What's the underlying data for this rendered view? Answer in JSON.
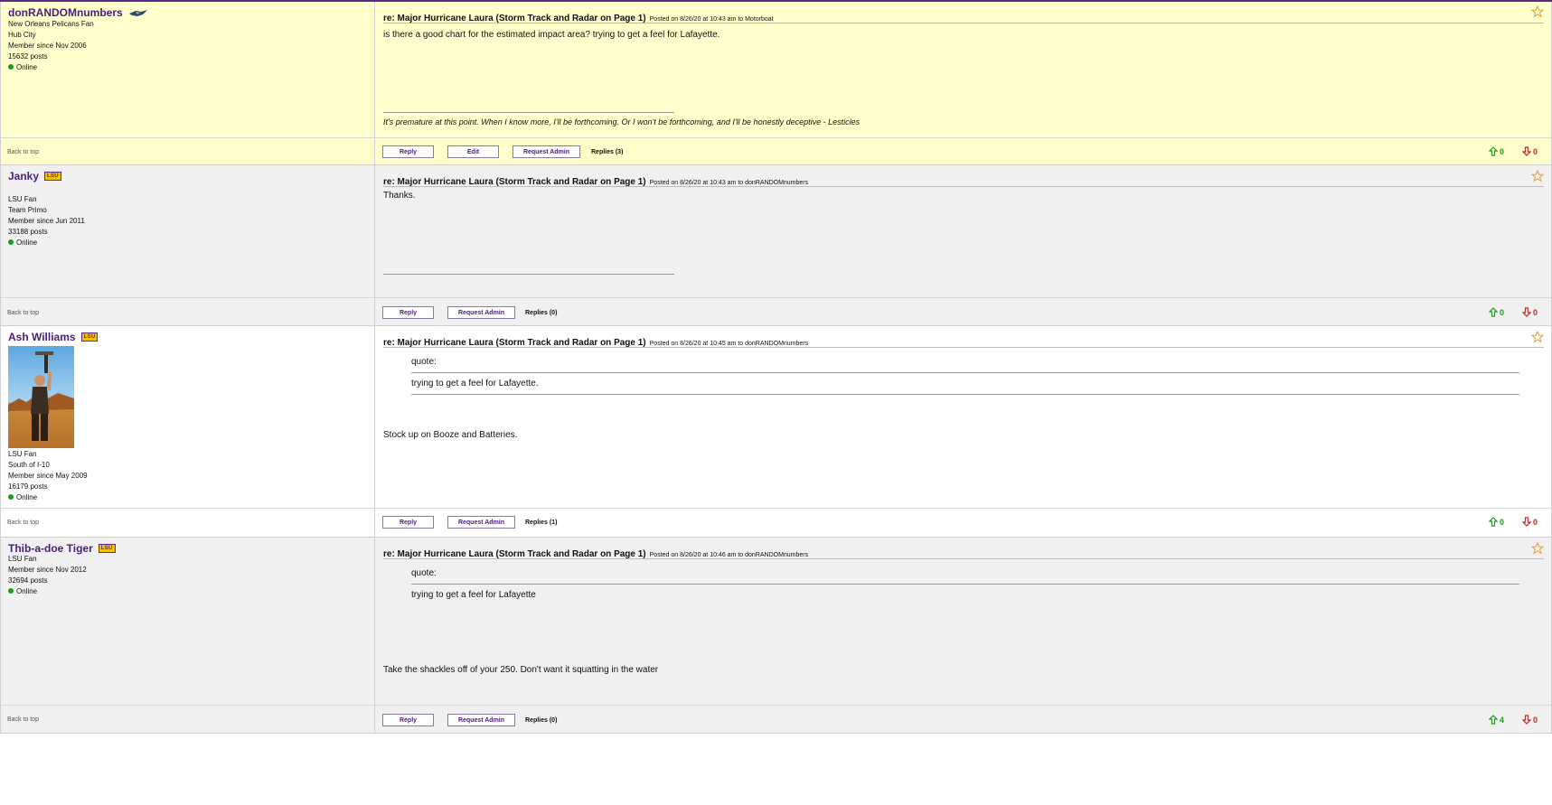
{
  "common": {
    "back_to_top": "Back to top",
    "reply_label": "Reply",
    "edit_label": "Edit",
    "request_admin_label": "Request Admin",
    "quote_label": "quote:",
    "subject_title": "re: Major Hurricane Laura (Storm Track and Radar on Page 1)"
  },
  "colors": {
    "own_post_bg": "#ffffcc",
    "alt_post_bg": "#f0f0f0",
    "white_post_bg": "#ffffff",
    "username": "#4b1c7a",
    "vote_up": "#1e9c1e",
    "vote_down": "#cc2222"
  },
  "posts": [
    {
      "username": "donRANDOMnumbers",
      "badge": "pelican-icon",
      "info": [
        "New Orleans Pelicans Fan",
        "Hub City",
        "Member since Nov 2006",
        "15632 posts"
      ],
      "status": "Online",
      "meta": "Posted on 8/26/20 at 10:43 am to Motorboat",
      "message": "is there a good chart for the estimated impact area? trying to get a feel for Lafayette.",
      "signature": "It's premature at this point. When I know more, I'll be forthcoming. Or I won't be forthcoming, and I'll be honestly deceptive - Lesticles",
      "replies": "Replies (3)",
      "votes_up": "0",
      "votes_down": "0"
    },
    {
      "username": "Janky",
      "badge": "LSU",
      "info": [
        "LSU Fan",
        "Team Primo",
        "Member since Jun 2011",
        "33188 posts"
      ],
      "status": "Online",
      "meta": "Posted on 8/26/20 at 10:43 am to donRANDOMnumbers",
      "message": "Thanks.",
      "replies": "Replies (0)",
      "votes_up": "0",
      "votes_down": "0"
    },
    {
      "username": "Ash Williams",
      "badge": "LSU",
      "info": [
        "LSU Fan",
        "South of I-10",
        "Member since May 2009",
        "16179 posts"
      ],
      "status": "Online",
      "meta": "Posted on 8/26/20 at 10:45 am to donRANDOMnumbers",
      "quote": "trying to get a feel for Lafayette.",
      "message": "Stock up on Booze and Batteries.",
      "replies": "Replies (1)",
      "votes_up": "0",
      "votes_down": "0"
    },
    {
      "username": "Thib-a-doe Tiger",
      "badge": "LSU",
      "info": [
        "LSU Fan",
        "Member since Nov 2012",
        "32694 posts"
      ],
      "status": "Online",
      "meta": "Posted on 8/26/20 at 10:46 am to donRANDOMnumbers",
      "quote": "trying to get a feel for Lafayette",
      "message": "Take the shackles off of your 250. Don't want it squatting in the water",
      "replies": "Replies (0)",
      "votes_up": "4",
      "votes_down": "0"
    }
  ]
}
